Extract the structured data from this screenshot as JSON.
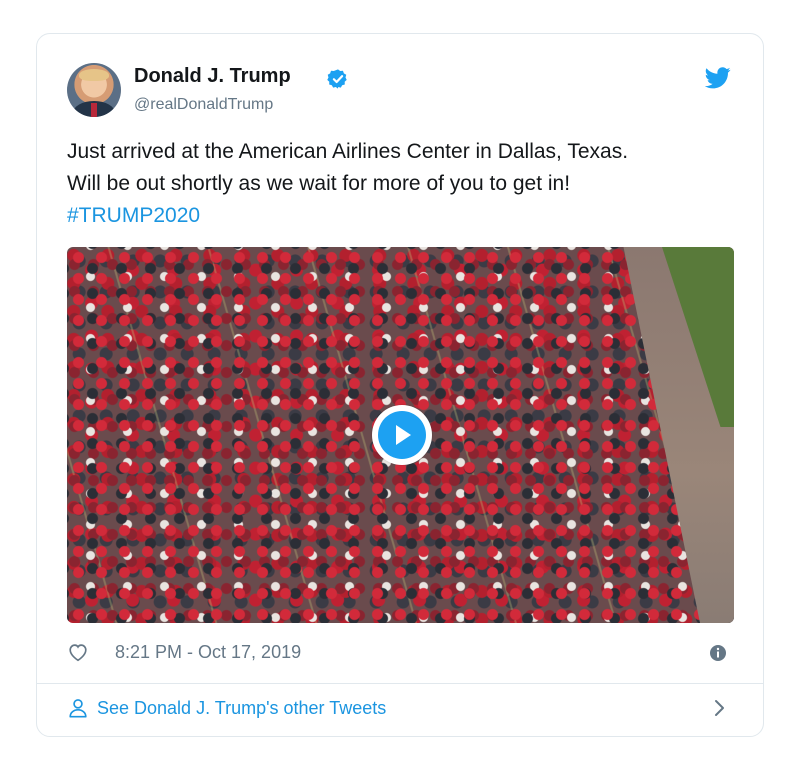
{
  "tweet": {
    "author_name": "Donald J. Trump",
    "handle": "@realDonaldTrump",
    "text_line1": "Just arrived at the American Airlines Center in Dallas, Texas.",
    "text_line2": "Will be out shortly as we wait for more of you to get in!",
    "hashtag": "#TRUMP2020",
    "timestamp": "8:21 PM - Oct 17, 2019",
    "see_more": "See Donald J. Trump's other Tweets"
  },
  "icons": {
    "verified": "verified-badge-icon",
    "logo": "twitter-bird-icon",
    "play": "play-icon",
    "like": "heart-icon",
    "info": "info-icon",
    "profile": "person-icon",
    "chevron": "chevron-right-icon"
  },
  "colors": {
    "accent": "#1da1f2",
    "link": "#1b95e0",
    "muted": "#657786",
    "border": "#e1e8ed"
  }
}
